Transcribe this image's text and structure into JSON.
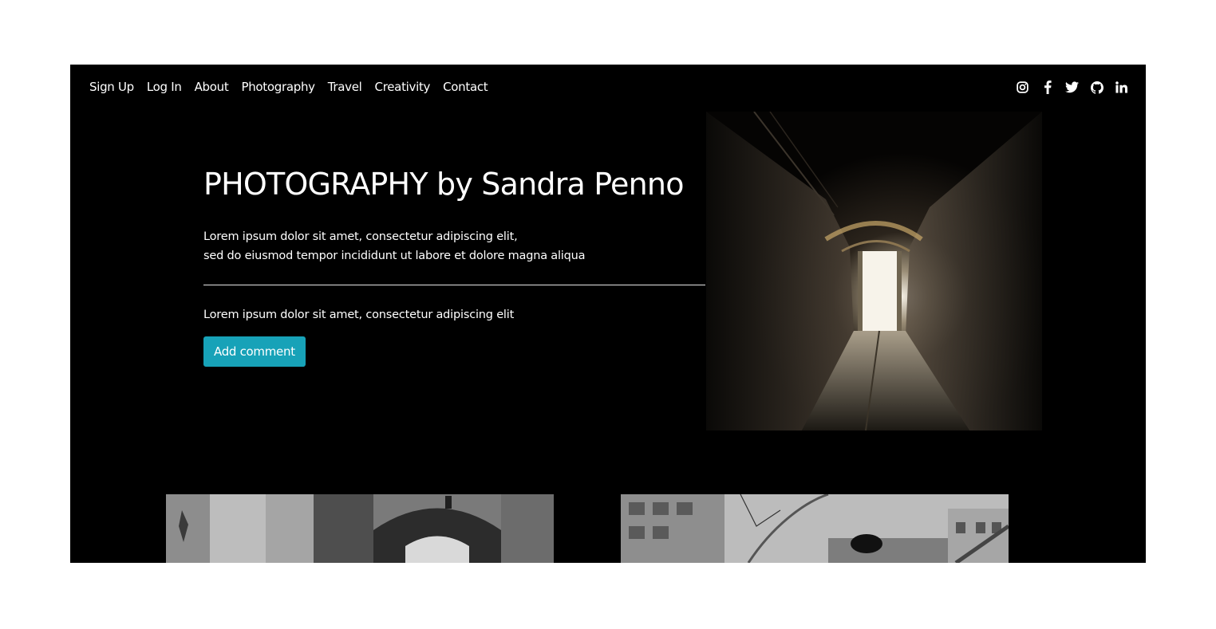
{
  "nav": {
    "links": [
      "Sign Up",
      "Log In",
      "About",
      "Photography",
      "Travel",
      "Creativity",
      "Contact"
    ],
    "social_icons": [
      "instagram-icon",
      "facebook-icon",
      "twitter-icon",
      "github-icon",
      "linkedin-icon"
    ]
  },
  "hero": {
    "title": "PHOTOGRAPHY by Sandra Penno",
    "lead_line1": "Lorem ipsum dolor sit amet, consectetur adipiscing elit,",
    "lead_line2": "sed do eiusmod tempor incididunt ut labore et dolore magna aliqua",
    "sub": "Lorem ipsum dolor sit amet, consectetur adipiscing elit",
    "button_label": "Add comment"
  },
  "colors": {
    "page_bg": "#000000",
    "button_bg": "#17a2b8",
    "text": "#ffffff"
  }
}
